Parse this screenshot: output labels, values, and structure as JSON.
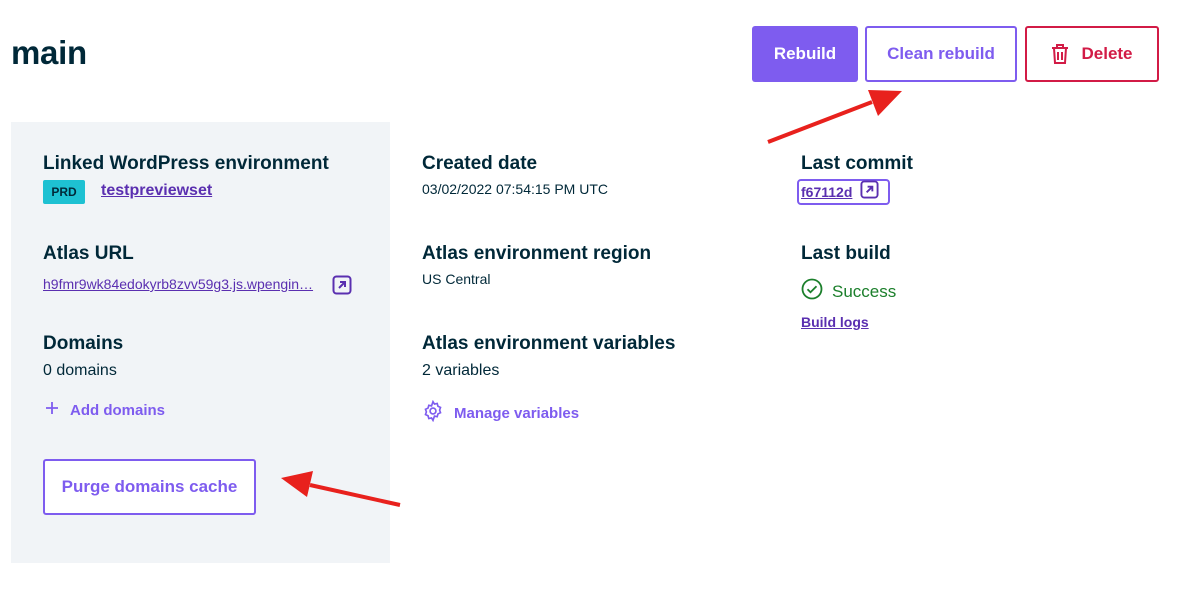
{
  "page": {
    "title": "main"
  },
  "toolbar": {
    "rebuild_label": "Rebuild",
    "clean_rebuild_label": "Clean rebuild",
    "delete_label": "Delete"
  },
  "linked_env": {
    "label": "Linked WordPress environment",
    "badge": "PRD",
    "name": "testpreviewset"
  },
  "atlas_url": {
    "label": "Atlas URL",
    "value": "h9fmr9wk84edokyrb8zvv59g3.js.wpengin…"
  },
  "domains": {
    "label": "Domains",
    "count": "0 domains",
    "add_label": "Add domains",
    "purge_label": "Purge domains cache"
  },
  "created": {
    "label": "Created date",
    "value": "03/02/2022 07:54:15 PM UTC"
  },
  "region": {
    "label": "Atlas environment region",
    "value": "US Central"
  },
  "variables": {
    "label": "Atlas environment variables",
    "count": "2 variables",
    "manage_label": "Manage variables"
  },
  "last_commit": {
    "label": "Last commit",
    "hash": "f67112d"
  },
  "last_build": {
    "label": "Last build",
    "status": "Success",
    "logs_label": "Build logs"
  },
  "colors": {
    "accent": "#7e5cef",
    "danger": "#d21b46",
    "success": "#1b7f2b",
    "badge": "#1ec1d2",
    "panel": "#f1f4f7",
    "annotation_arrow": "#e8211d"
  }
}
